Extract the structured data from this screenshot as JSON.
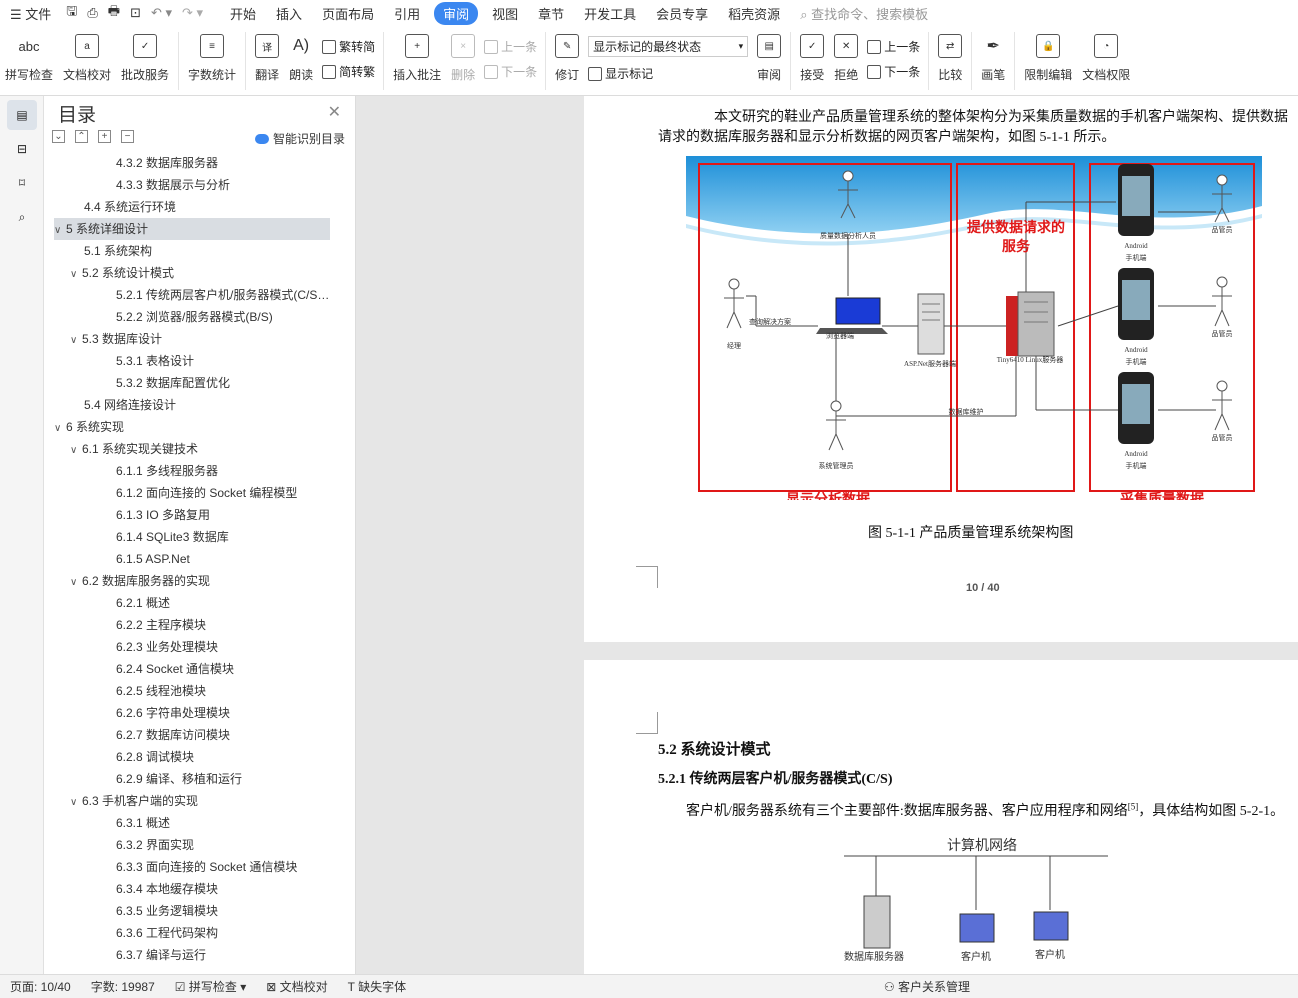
{
  "menu": {
    "file": "文件",
    "tabs": [
      "开始",
      "插入",
      "页面布局",
      "引用",
      "审阅",
      "视图",
      "章节",
      "开发工具",
      "会员专享",
      "稻壳资源"
    ],
    "active": "审阅",
    "search": "查找命令、搜索模板"
  },
  "ribbon": {
    "spell": "拼写检查",
    "proof": "文档校对",
    "annotate": "批改服务",
    "wordcount": "字数统计",
    "translate": "翻译",
    "read": "朗读",
    "trad": "繁转简",
    "simp": "简转繁",
    "insert_comment": "插入批注",
    "delete": "删除",
    "prev_comment": "上一条",
    "next_comment": "下一条",
    "revise": "修订",
    "markup_state": "显示标记的最终状态",
    "show_markup": "显示标记",
    "review": "审阅",
    "accept": "接受",
    "reject": "拒绝",
    "prev_change": "上一条",
    "next_change": "下一条",
    "compare": "比较",
    "pen": "画笔",
    "restrict": "限制编辑",
    "permission": "文档权限",
    "abc": "abc"
  },
  "toc": {
    "title": "目录",
    "smart": "智能识别目录",
    "items": [
      {
        "text": "4.3.2 数据库服务器",
        "level": 3,
        "arrow": ""
      },
      {
        "text": "4.3.3 数据展示与分析",
        "level": 3,
        "arrow": ""
      },
      {
        "text": "4.4 系统运行环境",
        "level": 2,
        "arrow": ""
      },
      {
        "text": "5 系统详细设计",
        "level": 1,
        "arrow": "∨",
        "selected": true
      },
      {
        "text": "5.1 系统架构",
        "level": 2,
        "arrow": ""
      },
      {
        "text": "5.2 系统设计模式",
        "level": 2,
        "arrow": "∨"
      },
      {
        "text": "5.2.1 传统两层客户机/服务器模式(C/S ...",
        "level": 3,
        "arrow": ""
      },
      {
        "text": "5.2.2 浏览器/服务器模式(B/S)",
        "level": 3,
        "arrow": ""
      },
      {
        "text": "5.3 数据库设计",
        "level": 2,
        "arrow": "∨"
      },
      {
        "text": "5.3.1 表格设计",
        "level": 3,
        "arrow": ""
      },
      {
        "text": "5.3.2 数据库配置优化",
        "level": 3,
        "arrow": ""
      },
      {
        "text": "5.4 网络连接设计",
        "level": 2,
        "arrow": ""
      },
      {
        "text": "6 系统实现",
        "level": 1,
        "arrow": "∨"
      },
      {
        "text": "6.1 系统实现关键技术",
        "level": 2,
        "arrow": "∨"
      },
      {
        "text": "6.1.1 多线程服务器",
        "level": 3,
        "arrow": ""
      },
      {
        "text": "6.1.2 面向连接的 Socket 编程模型",
        "level": 3,
        "arrow": ""
      },
      {
        "text": "6.1.3 IO 多路复用",
        "level": 3,
        "arrow": ""
      },
      {
        "text": "6.1.4 SQLite3 数据库",
        "level": 3,
        "arrow": ""
      },
      {
        "text": "6.1.5 ASP.Net",
        "level": 3,
        "arrow": ""
      },
      {
        "text": "6.2 数据库服务器的实现",
        "level": 2,
        "arrow": "∨"
      },
      {
        "text": "6.2.1 概述",
        "level": 3,
        "arrow": ""
      },
      {
        "text": "6.2.2 主程序模块",
        "level": 3,
        "arrow": ""
      },
      {
        "text": "6.2.3 业务处理模块",
        "level": 3,
        "arrow": ""
      },
      {
        "text": "6.2.4 Socket 通信模块",
        "level": 3,
        "arrow": ""
      },
      {
        "text": "6.2.5 线程池模块",
        "level": 3,
        "arrow": ""
      },
      {
        "text": "6.2.6 字符串处理模块",
        "level": 3,
        "arrow": ""
      },
      {
        "text": "6.2.7 数据库访问模块",
        "level": 3,
        "arrow": ""
      },
      {
        "text": "6.2.8 调试模块",
        "level": 3,
        "arrow": ""
      },
      {
        "text": "6.2.9 编译、移植和运行",
        "level": 3,
        "arrow": ""
      },
      {
        "text": "6.3 手机客户端的实现",
        "level": 2,
        "arrow": "∨"
      },
      {
        "text": "6.3.1 概述",
        "level": 3,
        "arrow": ""
      },
      {
        "text": "6.3.2 界面实现",
        "level": 3,
        "arrow": ""
      },
      {
        "text": "6.3.3 面向连接的 Socket 通信模块",
        "level": 3,
        "arrow": ""
      },
      {
        "text": "6.3.4 本地缓存模块",
        "level": 3,
        "arrow": ""
      },
      {
        "text": "6.3.5 业务逻辑模块",
        "level": 3,
        "arrow": ""
      },
      {
        "text": "6.3.6 工程代码架构",
        "level": 3,
        "arrow": ""
      },
      {
        "text": "6.3.7 编译与运行",
        "level": 3,
        "arrow": ""
      }
    ]
  },
  "page1": {
    "para_line1": "本文研究的鞋业产品质量管理系统的整体架构分为采集质量数据的手机客户端架构、提供数据",
    "para_line2": "请求的数据库服务器和显示分析数据的网页客户端架构，如图 5-1-1 所示。",
    "caption": "图 5-1-1 产品质量管理系统架构图",
    "page_num": "10 / 40",
    "fig": {
      "label_left": "显示分析数据",
      "label_mid": "采集质量数据",
      "label_center_top": "提供数据请求的",
      "label_center_top2": "服务",
      "analyst": "质量数据分析人员",
      "manager": "经理",
      "query": "查询解决方案",
      "browser": "浏览器端",
      "asp": "ASP.Net服务器端",
      "tiny": "Tiny6410 Linux服务器",
      "dbmaint": "数据库维护",
      "admin": "系统管理员",
      "android": "Android",
      "phone": "手机端",
      "inspector": "品管员"
    }
  },
  "page2": {
    "h2": "5.2 系统设计模式",
    "h3": "5.2.1 传统两层客户机/服务器模式(C/S)",
    "para": "客户机/服务器系统有三个主要部件:数据库服务器、客户应用程序和网络",
    "cite": "[5]",
    "para_end": "，具体结构如图 5-2-1。",
    "net": "计算机网络",
    "dbserver": "数据库服务器",
    "client": "客户机"
  },
  "status": {
    "page": "页面: 10/40",
    "words": "字数: 19987",
    "spell": "拼写检查",
    "proof": "文档校对",
    "missing_font": "缺失字体",
    "crm": "客户关系管理"
  }
}
